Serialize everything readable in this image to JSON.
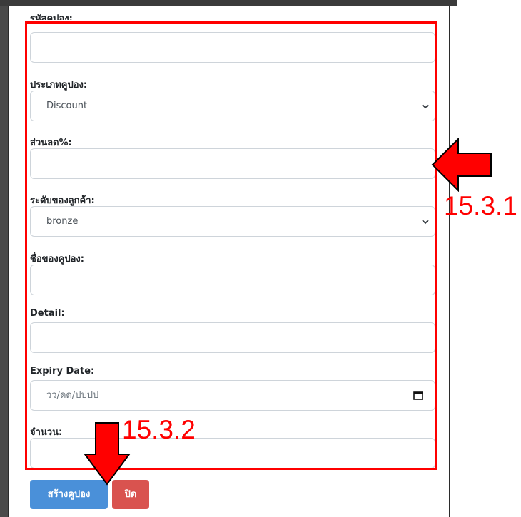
{
  "form": {
    "coupon_code_label": "รหัสคูปอง:",
    "coupon_code_value": "",
    "coupon_type_label": "ประเภทคูปอง:",
    "coupon_type_selected": "Discount",
    "discount_label": "ส่วนลด%:",
    "discount_value": "",
    "customer_level_label": "ระดับของลูกค้า:",
    "customer_level_selected": "bronze",
    "coupon_name_label": "ชื่อของคูปอง:",
    "coupon_name_value": "",
    "detail_label": "Detail:",
    "detail_value": "",
    "expiry_label": "Expiry Date:",
    "expiry_placeholder": "วว/ดด/ปปปป",
    "quantity_label": "จำนวน:",
    "quantity_value": ""
  },
  "buttons": {
    "create_label": "สร้างคูปอง",
    "close_label": "ปิด"
  },
  "annotations": {
    "step_1": "15.3.1",
    "step_2": "15.3.2",
    "color": "#ff0000"
  },
  "icons": {
    "select_arrow": "chevron-down-icon",
    "date_picker": "calendar-icon",
    "pointer": "arrow-icon"
  }
}
